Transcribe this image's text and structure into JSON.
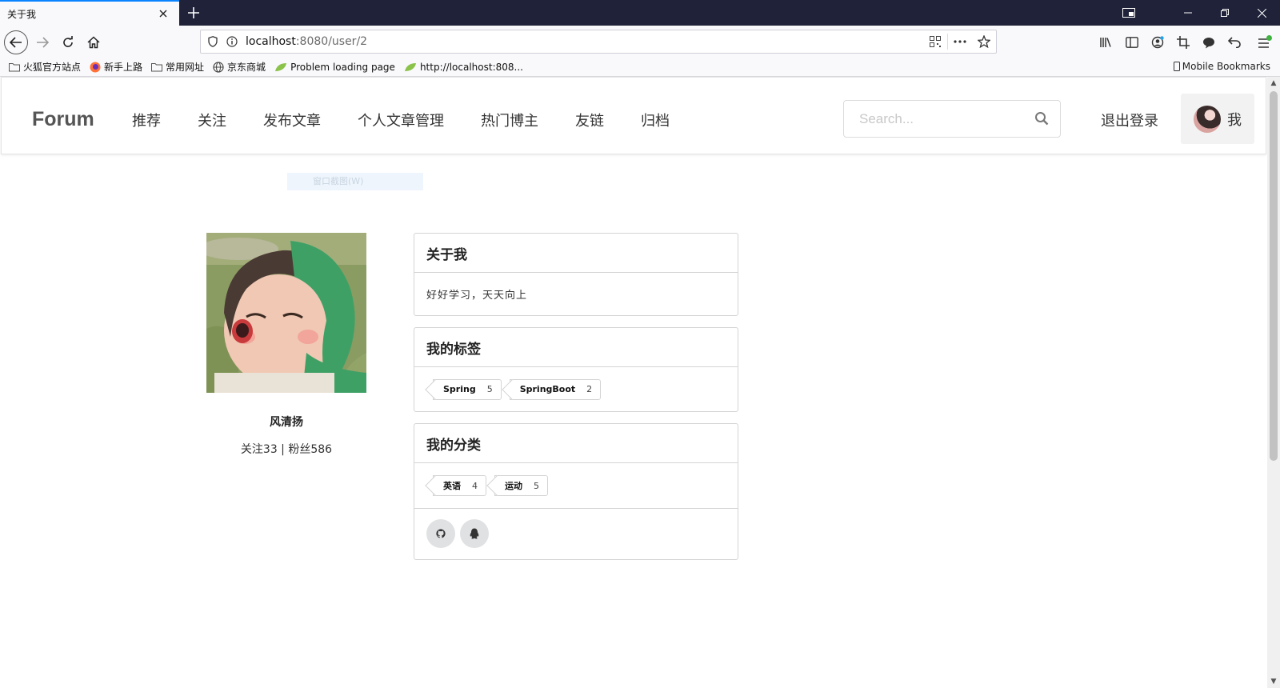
{
  "browser": {
    "tab_title": "关于我",
    "url_host": "localhost",
    "url_rest": ":8080/user/2",
    "bookmarks": [
      "火狐官方站点",
      "新手上路",
      "常用网址",
      "京东商城",
      "Problem loading page",
      "http://localhost:808..."
    ],
    "mobile_bookmarks": "Mobile Bookmarks"
  },
  "site": {
    "brand": "Forum",
    "menu": [
      "推荐",
      "关注",
      "发布文章",
      "个人文章管理",
      "热门博主",
      "友链",
      "归档"
    ],
    "search_placeholder": "Search...",
    "logout": "退出登录",
    "me": "我"
  },
  "ghost_tooltip": "窗口截图(W)",
  "profile": {
    "username": "风清扬",
    "follow_stats": "关注33 | 粉丝586"
  },
  "about": {
    "title": "关于我",
    "text": "好好学习，天天向上"
  },
  "tags": {
    "title": "我的标签",
    "items": [
      {
        "name": "Spring",
        "count": "5"
      },
      {
        "name": "SpringBoot",
        "count": "2"
      }
    ]
  },
  "categories": {
    "title": "我的分类",
    "items": [
      {
        "name": "英语",
        "count": "4"
      },
      {
        "name": "运动",
        "count": "5"
      }
    ]
  },
  "social_icons": [
    "github-icon",
    "qq-icon"
  ]
}
